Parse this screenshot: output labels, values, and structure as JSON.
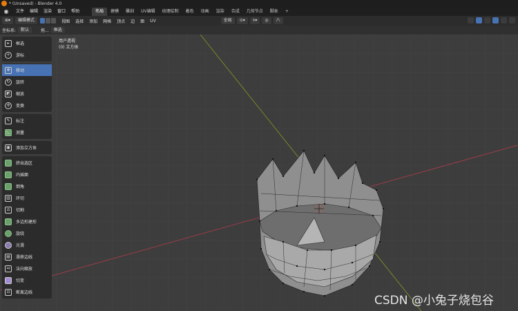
{
  "window": {
    "title": "* (Unsaved) - Blender 4.0"
  },
  "menu": [
    "文件",
    "编辑",
    "渲染",
    "窗口",
    "帮助"
  ],
  "workspaces": [
    "布局",
    "建模",
    "雕刻",
    "UV编辑",
    "纹理绘制",
    "着色",
    "动画",
    "渲染",
    "合成",
    "几何节点",
    "脚本",
    "+"
  ],
  "header": {
    "mode": "编辑模式",
    "menus": [
      "视图",
      "选择",
      "添加",
      "网格",
      "顶点",
      "边",
      "面",
      "UV"
    ],
    "orientation": "全局",
    "snap_label": "八"
  },
  "header2": {
    "coord_label": "坐标系:",
    "coord_value": "默认",
    "drag_label": "拖...",
    "select_value": "框选"
  },
  "viewport": {
    "view_name": "用户透视",
    "object_name": "(0) 立方体"
  },
  "tools": [
    [
      "框选",
      "游标"
    ],
    [
      "移动",
      "旋转",
      "缩放",
      "变换"
    ],
    [
      "标注",
      "测量"
    ],
    [
      "添加立方体"
    ],
    [
      "挤出选区",
      "内插面",
      "倒角",
      "环切",
      "切割",
      "多边形建形",
      "旋绕",
      "光滑",
      "滑移边线",
      "法向缩放",
      "切变",
      "断离边线"
    ]
  ],
  "active_tool": "移动",
  "watermark": "CSDN @小兔子烧包谷",
  "colors": {
    "accent": "#4772b3",
    "x_axis": "#9c3d49",
    "y_axis": "#7a8a2a",
    "mesh": "#a9a9a9"
  }
}
